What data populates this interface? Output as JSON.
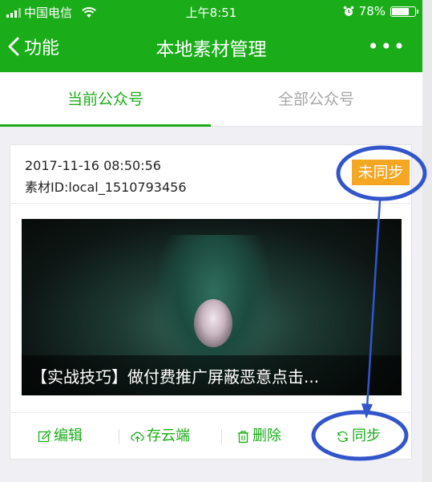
{
  "status_bar": {
    "carrier": "中国电信",
    "time": "上午8:51",
    "battery": "78%",
    "battery_level": 0.78
  },
  "nav": {
    "back_label": "功能",
    "title": "本地素材管理",
    "more_label": "•••"
  },
  "tabs": [
    {
      "label": "当前公众号",
      "active": true
    },
    {
      "label": "全部公众号",
      "active": false
    }
  ],
  "card": {
    "date": "2017-11-16 08:50:56",
    "material_id": "素材ID:local_1510793456",
    "sync_badge": "未同步",
    "cover_caption": "【实战技巧】做付费推广屏蔽恶意点击...",
    "actions": {
      "edit": "编辑",
      "cloud": "存云端",
      "delete": "删除",
      "sync": "同步"
    }
  },
  "colors": {
    "brand_green": "#1aad19",
    "badge_orange": "#f5a623",
    "annotation_blue": "#3355cc"
  }
}
